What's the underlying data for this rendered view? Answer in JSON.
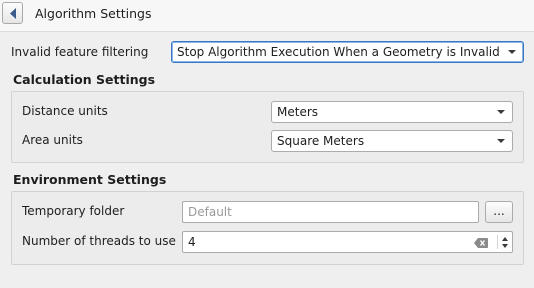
{
  "header": {
    "title": "Algorithm Settings",
    "back_icon": "chevron-left-icon"
  },
  "invalid_filtering": {
    "label": "Invalid feature filtering",
    "value": "Stop Algorithm Execution When a Geometry is Invalid"
  },
  "calculation": {
    "title": "Calculation Settings",
    "distance_label": "Distance units",
    "distance_value": "Meters",
    "area_label": "Area units",
    "area_value": "Square Meters"
  },
  "environment": {
    "title": "Environment Settings",
    "temp_label": "Temporary folder",
    "temp_placeholder": "Default",
    "temp_button": "...",
    "threads_label": "Number of threads to use",
    "threads_value": "4"
  },
  "colors": {
    "focus_border": "#3a78c3",
    "background": "#efefef"
  }
}
